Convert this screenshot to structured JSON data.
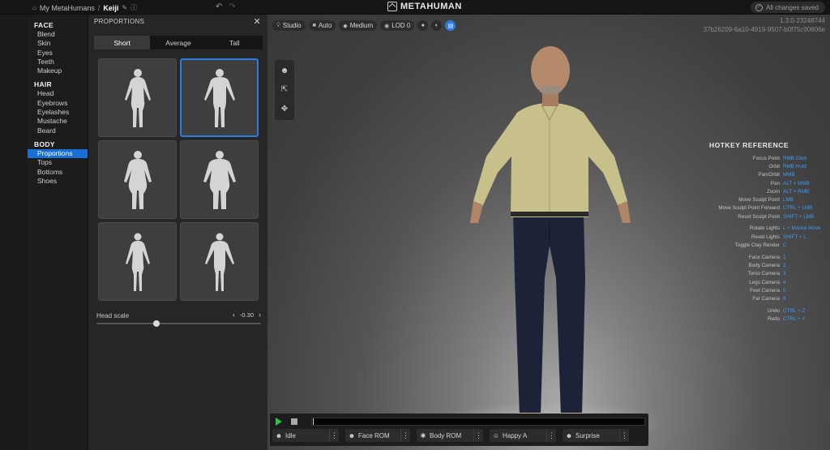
{
  "topbar": {
    "breadcrumb_root": "My MetaHumans",
    "breadcrumb_sep": "/",
    "character_name": "Keiji",
    "brand": "METAHUMAN",
    "save_status": "All changes saved"
  },
  "nav": {
    "sections": [
      {
        "title": "FACE",
        "items": [
          "Blend",
          "Skin",
          "Eyes",
          "Teeth",
          "Makeup"
        ]
      },
      {
        "title": "HAIR",
        "items": [
          "Head",
          "Eyebrows",
          "Eyelashes",
          "Mustache",
          "Beard"
        ]
      },
      {
        "title": "BODY",
        "items": [
          "Proportions",
          "Tops",
          "Bottoms",
          "Shoes"
        ]
      }
    ],
    "active_item": "Proportions"
  },
  "panel": {
    "title": "PROPORTIONS",
    "tabs": [
      "Short",
      "Average",
      "Tall"
    ],
    "active_tab": "Short",
    "selected_tile": 2,
    "head_scale_label": "Head scale",
    "head_scale_value": "-0.30",
    "head_scale_level": 0.36
  },
  "viewport": {
    "toolbar": [
      {
        "icon": "lightbulb-icon",
        "label": "Studio"
      },
      {
        "icon": "camera-icon",
        "label": "Auto"
      },
      {
        "icon": "diamond-icon",
        "label": "Medium"
      },
      {
        "icon": "lod-icon",
        "label": "LOD 0"
      }
    ],
    "version": "1.3.0-23248744",
    "hash": "37b26209-6a10-4919-9507-b0f75c90606e",
    "hotkey_title": "HOTKEY REFERENCE",
    "hotkeys": [
      {
        "action": "Focus Point",
        "key": "RMB Click"
      },
      {
        "action": "Orbit",
        "key": "RMB Hold"
      },
      {
        "action": "Pan/Orbit",
        "key": "MMB"
      },
      {
        "action": "Pan",
        "key": "ALT + MMB"
      },
      {
        "action": "Zoom",
        "key": "ALT + RMB"
      },
      {
        "action": "Move Sculpt Point",
        "key": "LMB"
      },
      {
        "action": "Move Sculpt Point Forward",
        "key": "CTRL + LMB"
      },
      {
        "action": "Reset Sculpt Point",
        "key": "SHIFT + LMB"
      },
      {
        "action": "Rotate Lights",
        "key": "L + Mouse Move"
      },
      {
        "action": "Reset Lights",
        "key": "SHIFT + L"
      },
      {
        "action": "Toggle Clay Render",
        "key": "C"
      },
      {
        "action": "Face Camera",
        "key": "1"
      },
      {
        "action": "Body Camera",
        "key": "2"
      },
      {
        "action": "Torso Camera",
        "key": "3"
      },
      {
        "action": "Legs Camera",
        "key": "4"
      },
      {
        "action": "Feet Camera",
        "key": "5"
      },
      {
        "action": "Far Camera",
        "key": "6"
      },
      {
        "action": "Undo",
        "key": "CTRL + Z"
      },
      {
        "action": "Redo",
        "key": "CTRL + Y"
      }
    ]
  },
  "bottom": {
    "animations": [
      {
        "icon": "idle-icon",
        "label": "Idle"
      },
      {
        "icon": "face-icon",
        "label": "Face ROM"
      },
      {
        "icon": "run-icon",
        "label": "Body ROM"
      },
      {
        "icon": "happy-icon",
        "label": "Happy A"
      },
      {
        "icon": "surprise-icon",
        "label": "Surprise"
      }
    ]
  },
  "colors": {
    "accent": "#1a6fd4",
    "hotkey_key": "#3c9cf5",
    "play": "#35c24a"
  }
}
